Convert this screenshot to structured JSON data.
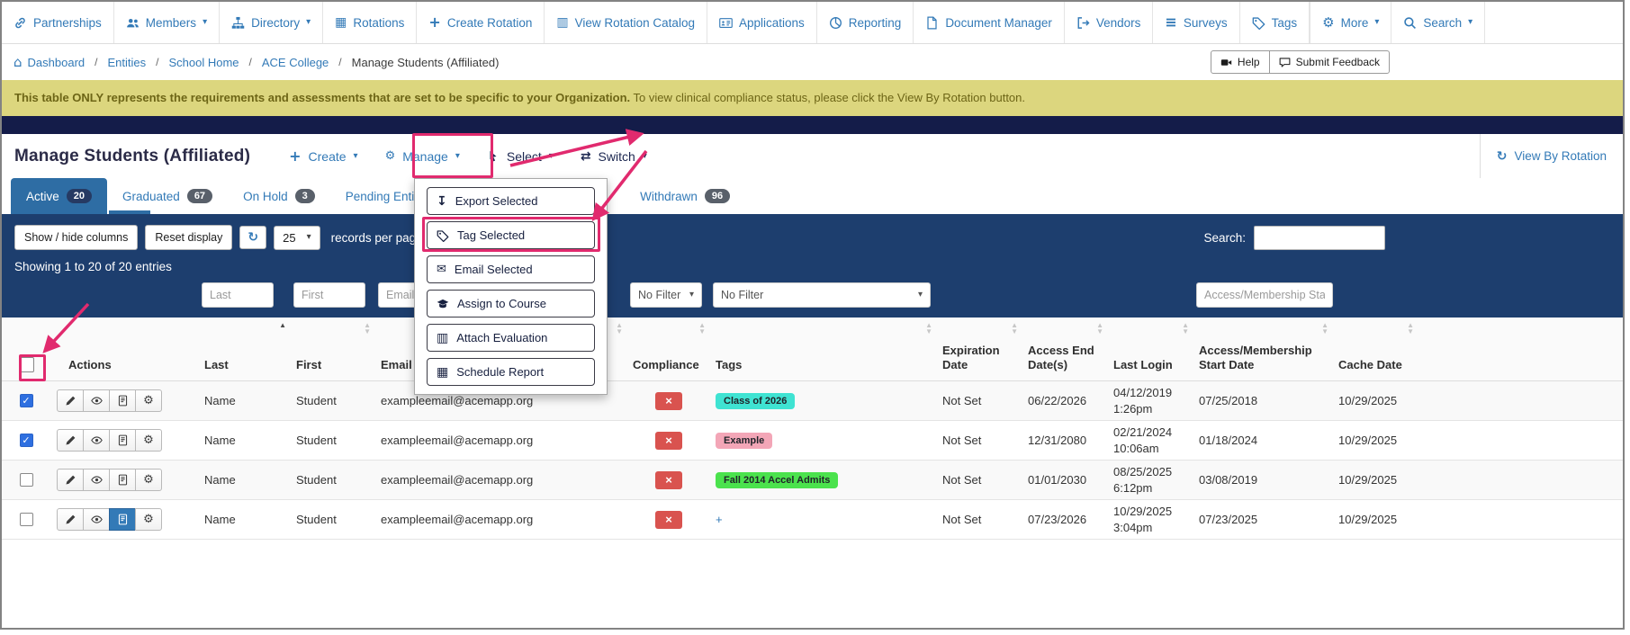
{
  "annotation_color": "#e12a6e",
  "accent_blue": "#337ab7",
  "navy_bar_color": "#1d3e6e",
  "nav": {
    "items": [
      {
        "label": "Partnerships",
        "icon": "link-icon"
      },
      {
        "label": "Members",
        "icon": "users-icon"
      },
      {
        "label": "Directory",
        "icon": "sitemap-icon"
      },
      {
        "label": "Rotations",
        "icon": "table-icon"
      },
      {
        "label": "Create Rotation",
        "icon": "plus-icon"
      },
      {
        "label": "View Rotation Catalog",
        "icon": "columns-icon"
      },
      {
        "label": "Applications",
        "icon": "id-card-icon"
      },
      {
        "label": "Reporting",
        "icon": "pie-chart-icon"
      },
      {
        "label": "Document Manager",
        "icon": "file-icon"
      },
      {
        "label": "Vendors",
        "icon": "sign-out-icon"
      },
      {
        "label": "Surveys",
        "icon": "list-icon"
      },
      {
        "label": "Tags",
        "icon": "tag-icon"
      },
      {
        "label": "More",
        "icon": "gear-icon"
      },
      {
        "label": "Search",
        "icon": "search-icon"
      }
    ]
  },
  "breadcrumb": {
    "items": [
      "Dashboard",
      "Entities",
      "School Home",
      "ACE College"
    ],
    "current": "Manage Students (Affiliated)",
    "help": "Help",
    "feedback": "Submit Feedback"
  },
  "alert": {
    "bold": "This table ONLY represents the requirements and assessments that are set to be specific to your Organization.",
    "text": " To view clinical compliance status, please click the View By Rotation button."
  },
  "panel": {
    "title": "Manage Students (Affiliated)",
    "create": "Create",
    "manage": "Manage",
    "select": "Select",
    "switch": "Switch",
    "view_by_rotation": "View By Rotation"
  },
  "tabs": [
    {
      "label": "Active",
      "count": "20"
    },
    {
      "label": "Graduated",
      "count": "67"
    },
    {
      "label": "On Hold",
      "count": "3"
    },
    {
      "label": "Pending Entity Approval",
      "count": ""
    },
    {
      "label": "Withdrawn",
      "count": "96"
    }
  ],
  "select_menu": {
    "items": [
      {
        "label": "Export Selected",
        "icon": "download-icon"
      },
      {
        "label": "Tag Selected",
        "icon": "tag-icon"
      },
      {
        "label": "Email Selected",
        "icon": "envelope-icon"
      },
      {
        "label": "Assign to Course",
        "icon": "graduation-cap-icon"
      },
      {
        "label": "Attach Evaluation",
        "icon": "clipboard-icon"
      },
      {
        "label": "Schedule Report",
        "icon": "calendar-icon"
      }
    ]
  },
  "toolbar": {
    "show_hide": "Show / hide columns",
    "reset": "Reset display",
    "per_page": "25",
    "records": "records per page",
    "search_label": "Search:",
    "search_value": ""
  },
  "status": {
    "showing": "Showing 1 to 20 of 20 entries"
  },
  "filters": {
    "last": "Last",
    "first": "First",
    "email": "Email",
    "compliance": "No Filter",
    "tags": "No Filter",
    "start": "Access/Membership Start Date"
  },
  "table": {
    "headers": {
      "actions": "Actions",
      "last": "Last",
      "first": "First",
      "email": "Email",
      "compliance": "Compliance",
      "tags": "Tags",
      "expiration": "Expiration Date",
      "access_end": "Access End Date(s)",
      "last_login": "Last Login",
      "start": "Access/Membership Start Date",
      "cache": "Cache Date"
    },
    "rows": [
      {
        "checked": true,
        "last": "Name",
        "first": "Student",
        "email": "exampleemail@acemapp.org",
        "tag": "Class of 2026",
        "tag_color": "#3fe3d2",
        "expiration": "Not Set",
        "access_end": "06/22/2026",
        "login_date": "04/12/2019",
        "login_time": "1:26pm",
        "start": "07/25/2018",
        "cache": "10/29/2025"
      },
      {
        "checked": true,
        "last": "Name",
        "first": "Student",
        "email": "exampleemail@acemapp.org",
        "tag": "Example",
        "tag_color": "#f3a6b7",
        "expiration": "Not Set",
        "access_end": "12/31/2080",
        "login_date": "02/21/2024",
        "login_time": "10:06am",
        "start": "01/18/2024",
        "cache": "10/29/2025"
      },
      {
        "checked": false,
        "last": "Name",
        "first": "Student",
        "email": "exampleemail@acemapp.org",
        "tag": "Fall 2014 Accel Admits",
        "tag_color": "#4be24d",
        "expiration": "Not Set",
        "access_end": "01/01/2030",
        "login_date": "08/25/2025",
        "login_time": "6:12pm",
        "start": "03/08/2019",
        "cache": "10/29/2025"
      },
      {
        "checked": false,
        "last": "Name",
        "first": "Student",
        "email": "exampleemail@acemapp.org",
        "tag": "+",
        "tag_color": "",
        "expiration": "Not Set",
        "access_end": "07/23/2026",
        "login_date": "10/29/2025",
        "login_time": "3:04pm",
        "start": "07/23/2025",
        "cache": "10/29/2025"
      }
    ]
  }
}
